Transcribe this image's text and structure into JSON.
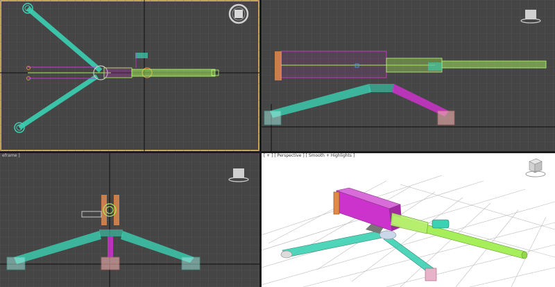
{
  "viewports": {
    "top": {
      "label": ""
    },
    "front": {
      "label": ""
    },
    "left": {
      "label": "eframe ]"
    },
    "perspective": {
      "label": "[ + ] [ Perspective ] [ Smooth + Highlights ]"
    }
  },
  "colors": {
    "viewport_bg": "#454545",
    "grid": "#5a5a5a",
    "axis": "#101010",
    "active_border": "#e0b050",
    "barrel": "#a6ef5a",
    "receiver": "#cc33cc",
    "tripod_leg": "#3bd1b3",
    "grip": "#e08a4a",
    "perspective_bg": "#ffffff"
  },
  "icons": {
    "viewcube": "viewcube-icon",
    "orbit": "orbit-ring-icon"
  }
}
